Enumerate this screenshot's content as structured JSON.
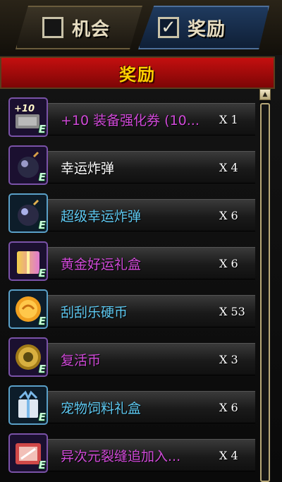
{
  "tabs": [
    {
      "label": "机会",
      "checked": false
    },
    {
      "label": "奖励",
      "checked": true
    }
  ],
  "header": {
    "title": "奖励"
  },
  "rewards": [
    {
      "name": "+10 装备强化券 (10...",
      "qty": "X 1",
      "icon": "enhance-ticket-icon",
      "name_color": "purple",
      "grade": "E",
      "icon_text": "+10"
    },
    {
      "name": "幸运炸弹",
      "qty": "X 4",
      "icon": "lucky-bomb-icon",
      "name_color": "white",
      "grade": "E"
    },
    {
      "name": "超级幸运炸弹",
      "qty": "X 6",
      "icon": "super-lucky-bomb-icon",
      "name_color": "blue",
      "grade": "E"
    },
    {
      "name": "黄金好运礼盒",
      "qty": "X 6",
      "icon": "golden-lucky-giftbox-icon",
      "name_color": "purple",
      "grade": "E"
    },
    {
      "name": "刮刮乐硬币",
      "qty": "X 53",
      "icon": "scratch-coin-icon",
      "name_color": "blue",
      "grade": "E"
    },
    {
      "name": "复活币",
      "qty": "X 3",
      "icon": "revival-coin-icon",
      "name_color": "purple",
      "grade": "E"
    },
    {
      "name": "宠物饲料礼盒",
      "qty": "X 6",
      "icon": "pet-food-giftbox-icon",
      "name_color": "blue",
      "grade": "E"
    },
    {
      "name": "异次元裂缝追加入...",
      "qty": "X 4",
      "icon": "dimension-rift-ticket-icon",
      "name_color": "purple",
      "grade": "E"
    }
  ],
  "colors": {
    "header_bg": "#b80d0d",
    "header_text": "#ffd200",
    "name_blue": "#5ec8f0",
    "name_purple": "#d04ad8"
  }
}
